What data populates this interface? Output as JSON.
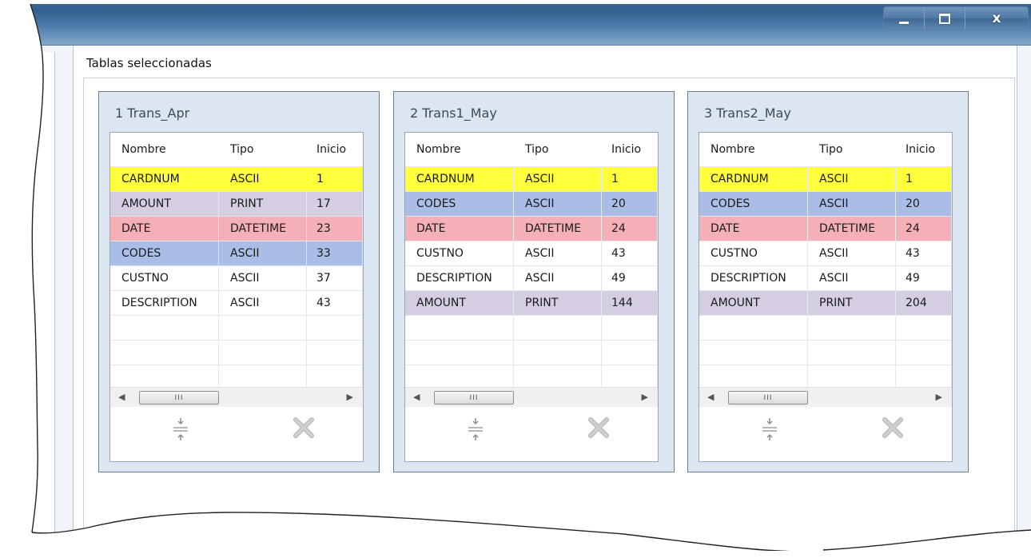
{
  "window": {
    "controls": {
      "minimize": "minimize",
      "maximize": "maximize",
      "close": "x"
    }
  },
  "section_label": "Tablas seleccionadas",
  "columns": {
    "name": "Nombre",
    "type": "Tipo",
    "start": "Inicio"
  },
  "scroll_grip": "III",
  "colors": {
    "yellow": "#ffff3c",
    "lilac": "#d5cde2",
    "rose": "#f4b0b6",
    "blue": "#a9bde6",
    "none": "#ffffff"
  },
  "panels": [
    {
      "title": "1 Trans_Apr",
      "rows": [
        {
          "name": "CARDNUM",
          "type": "ASCII",
          "start": "1",
          "color": "yellow"
        },
        {
          "name": "AMOUNT",
          "type": "PRINT",
          "start": "17",
          "color": "lilac"
        },
        {
          "name": "DATE",
          "type": "DATETIME",
          "start": "23",
          "color": "rose"
        },
        {
          "name": "CODES",
          "type": "ASCII",
          "start": "33",
          "color": "blue"
        },
        {
          "name": "CUSTNO",
          "type": "ASCII",
          "start": "37",
          "color": "none"
        },
        {
          "name": "DESCRIPTION",
          "type": "ASCII",
          "start": "43",
          "color": "none"
        }
      ]
    },
    {
      "title": "2 Trans1_May",
      "rows": [
        {
          "name": "CARDNUM",
          "type": "ASCII",
          "start": "1",
          "color": "yellow"
        },
        {
          "name": "CODES",
          "type": "ASCII",
          "start": "20",
          "color": "blue"
        },
        {
          "name": "DATE",
          "type": "DATETIME",
          "start": "24",
          "color": "rose"
        },
        {
          "name": "CUSTNO",
          "type": "ASCII",
          "start": "43",
          "color": "none"
        },
        {
          "name": "DESCRIPTION",
          "type": "ASCII",
          "start": "49",
          "color": "none"
        },
        {
          "name": "AMOUNT",
          "type": "PRINT",
          "start": "144",
          "color": "lilac"
        }
      ]
    },
    {
      "title": "3 Trans2_May",
      "rows": [
        {
          "name": "CARDNUM",
          "type": "ASCII",
          "start": "1",
          "color": "yellow"
        },
        {
          "name": "CODES",
          "type": "ASCII",
          "start": "20",
          "color": "blue"
        },
        {
          "name": "DATE",
          "type": "DATETIME",
          "start": "24",
          "color": "rose"
        },
        {
          "name": "CUSTNO",
          "type": "ASCII",
          "start": "43",
          "color": "none"
        },
        {
          "name": "DESCRIPTION",
          "type": "ASCII",
          "start": "49",
          "color": "none"
        },
        {
          "name": "AMOUNT",
          "type": "PRINT",
          "start": "204",
          "color": "lilac"
        }
      ]
    }
  ],
  "icons": {
    "sort": "sort-arrows-icon",
    "delete": "delete-x-icon"
  }
}
